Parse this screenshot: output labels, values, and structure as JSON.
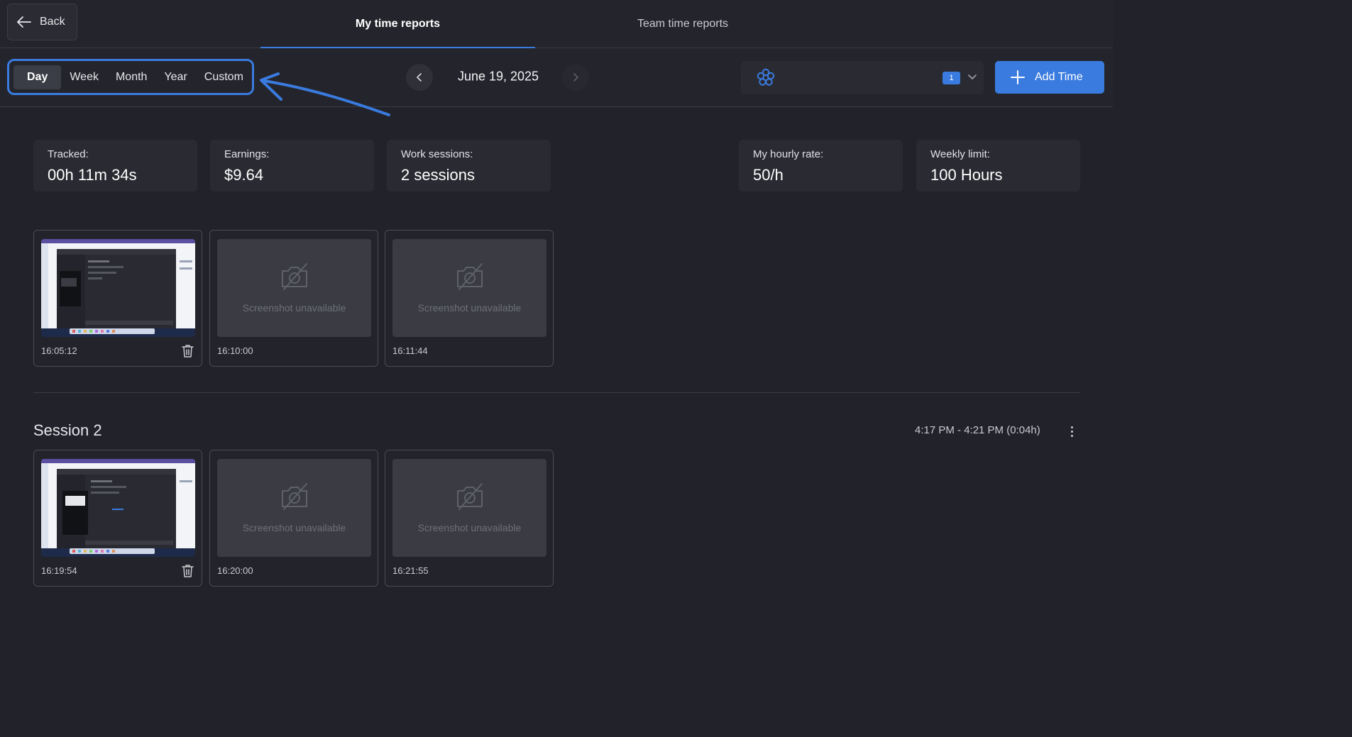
{
  "header": {
    "back_label": "Back",
    "tabs": [
      {
        "label": "My time reports",
        "active": true
      },
      {
        "label": "Team time reports",
        "active": false
      }
    ]
  },
  "toolbar": {
    "periods": [
      "Day",
      "Week",
      "Month",
      "Year",
      "Custom"
    ],
    "active_period": "Day",
    "date": "June 19, 2025",
    "project_count": "1",
    "add_time_label": "Add Time"
  },
  "stats": {
    "tracked": {
      "label": "Tracked:",
      "value": "00h 11m 34s"
    },
    "earnings": {
      "label": "Earnings:",
      "value": "$9.64"
    },
    "work_sessions": {
      "label": "Work sessions:",
      "value": "2 sessions"
    },
    "hourly_rate": {
      "label": "My hourly rate:",
      "value": "50/h"
    },
    "weekly_limit": {
      "label": "Weekly limit:",
      "value": "100 Hours"
    }
  },
  "sessions": [
    {
      "screenshots": [
        {
          "time": "16:05:12",
          "available": true
        },
        {
          "time": "16:10:00",
          "available": false,
          "placeholder": "Screenshot unavailable"
        },
        {
          "time": "16:11:44",
          "available": false,
          "placeholder": "Screenshot unavailable"
        }
      ]
    },
    {
      "title": "Session 2",
      "range": "4:17 PM - 4:21 PM (0:04h)",
      "screenshots": [
        {
          "time": "16:19:54",
          "available": true
        },
        {
          "time": "16:20:00",
          "available": false,
          "placeholder": "Screenshot unavailable"
        },
        {
          "time": "16:21:55",
          "available": false,
          "placeholder": "Screenshot unavailable"
        }
      ]
    }
  ],
  "colors": {
    "accent": "#3a7be0",
    "background": "#22232a",
    "card": "#2a2b32"
  }
}
